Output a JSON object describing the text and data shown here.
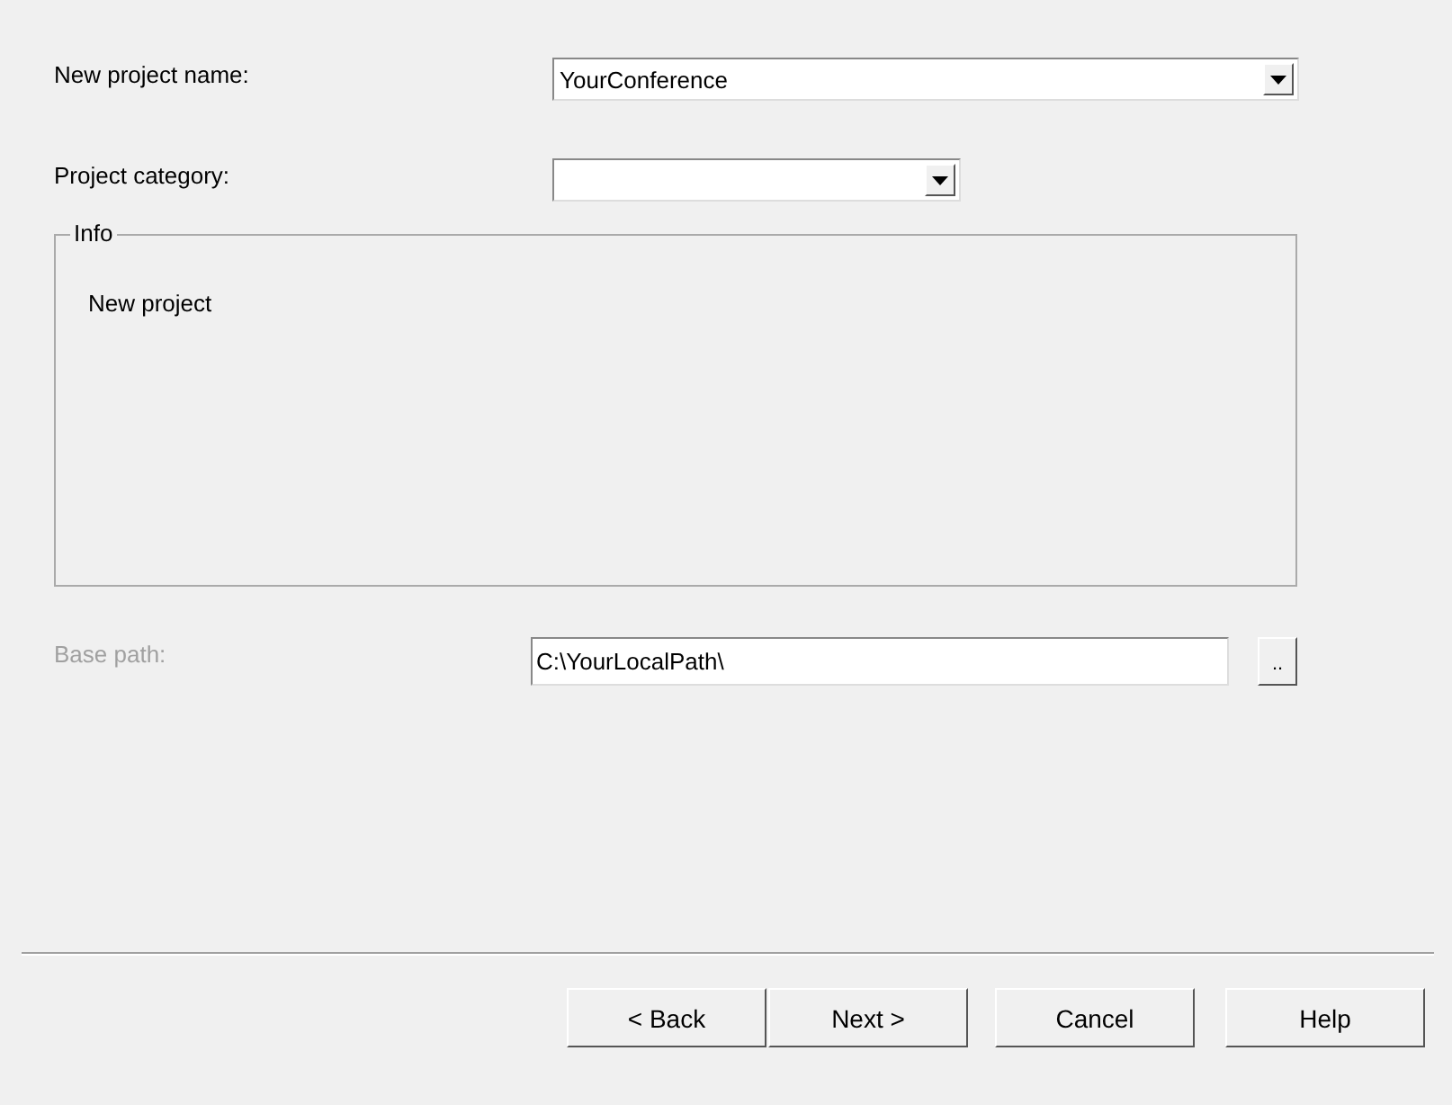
{
  "fields": [
    {
      "kind": "combo",
      "label": "New project name:",
      "value": "YourConference",
      "disabled": false
    },
    {
      "kind": "combo-short",
      "label": "Project category:",
      "disabled": false
    }
  ],
  "info": {
    "title": "Info",
    "text": "New project"
  },
  "base_path": {
    "label": "Base path:",
    "value": "C:\\YourLocalPath\\",
    "disabled": true,
    "browse": ".."
  },
  "buttons": [
    {
      "label": "< Back"
    },
    {
      "label": "Next >"
    },
    {
      "label": "Cancel"
    },
    {
      "label": "Help"
    }
  ]
}
